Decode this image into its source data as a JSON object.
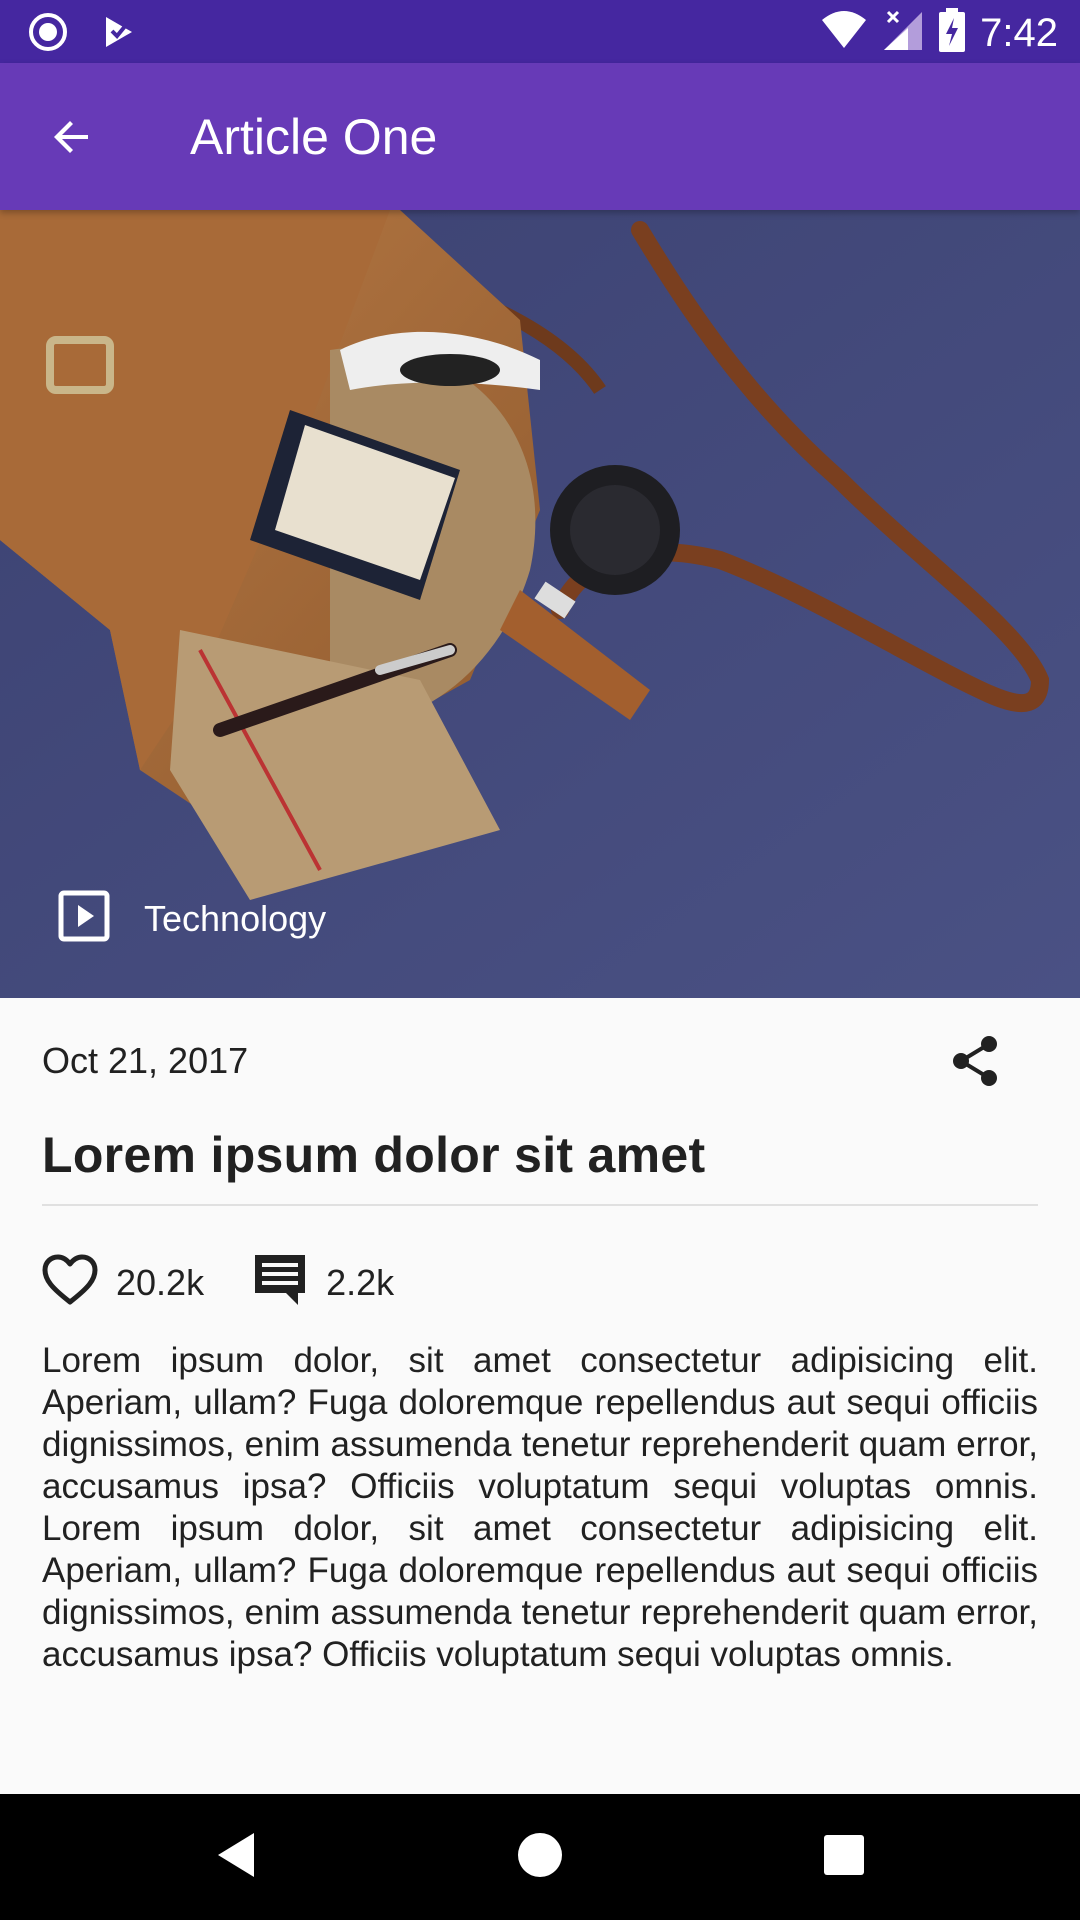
{
  "status_bar": {
    "time": "7:42",
    "left_icons": [
      "notification-circle-icon",
      "play-store-icon"
    ],
    "right_icons": [
      "wifi-icon",
      "signal-icon",
      "battery-charging-icon"
    ]
  },
  "app_bar": {
    "title": "Article One",
    "back_icon": "arrow-back-icon",
    "background": "#673ab7",
    "status_background": "#4527a0"
  },
  "hero": {
    "category_icon": "play-box-icon",
    "category": "Technology"
  },
  "article": {
    "date": "Oct 21, 2017",
    "share_icon": "share-icon",
    "title": "Lorem ipsum dolor sit amet",
    "likes": "20.2k",
    "like_icon": "heart-outline-icon",
    "comments": "2.2k",
    "comment_icon": "comment-icon",
    "body": "Lorem ipsum dolor, sit amet consectetur adipisicing elit. Aperiam, ullam? Fuga doloremque repellendus aut sequi officiis dignissimos, enim assumenda tenetur reprehenderit quam error, accusamus ipsa? Officiis voluptatum sequi voluptas omnis. Lorem ipsum dolor, sit amet consectetur adipisicing elit. Aperiam, ullam? Fuga doloremque repellendus aut sequi officiis dignissimos, enim assumenda tenetur reprehenderit quam error, accusamus ipsa? Officiis voluptatum sequi voluptas omnis."
  },
  "nav_bar": {
    "buttons": [
      "back-triangle-icon",
      "home-circle-icon",
      "recents-square-icon"
    ]
  }
}
